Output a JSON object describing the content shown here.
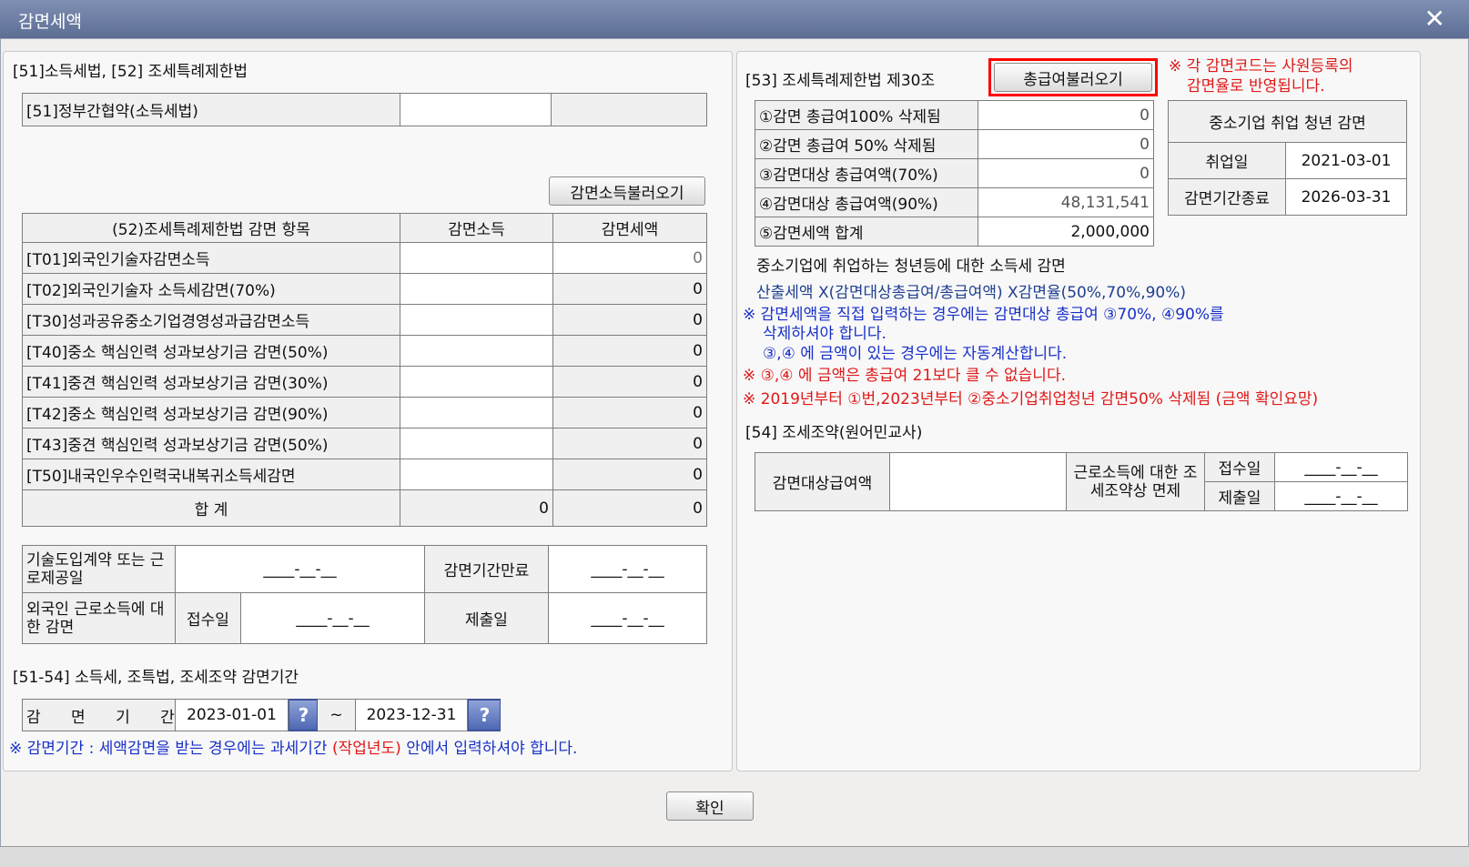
{
  "window": {
    "title": "감면세액",
    "close_icon": "✕"
  },
  "left": {
    "section_title": "[51]소득세법, [52] 조세특례제한법",
    "row51_label": "[51]정부간협약(소득세법)",
    "load_reduction_income_button": "감면소득불러오기",
    "table52": {
      "headers": [
        "(52)조세특례제한법 감면 항목",
        "감면소득",
        "감면세액"
      ],
      "rows": [
        {
          "label": "[T01]외국인기술자감면소득",
          "income": "",
          "tax": "0"
        },
        {
          "label": "[T02]외국인기술자 소득세감면(70%)",
          "income": "",
          "tax": "0"
        },
        {
          "label": "[T30]성과공유중소기업경영성과급감면소득",
          "income": "",
          "tax": "0"
        },
        {
          "label": "[T40]중소 핵심인력 성과보상기금 감면(50%)",
          "income": "",
          "tax": "0"
        },
        {
          "label": "[T41]중견 핵심인력 성과보상기금 감면(30%)",
          "income": "",
          "tax": "0"
        },
        {
          "label": "[T42]중소 핵심인력 성과보상기금 감면(90%)",
          "income": "",
          "tax": "0"
        },
        {
          "label": "[T43]중견 핵심인력 성과보상기금 감면(50%)",
          "income": "",
          "tax": "0"
        },
        {
          "label": "[T50]내국인우수인력국내복귀소득세감면",
          "income": "",
          "tax": "0"
        }
      ],
      "total_label": "합  계",
      "total_income": "0",
      "total_tax": "0"
    },
    "foreign": {
      "contract_label": "기술도입계약 또는 근로제공일",
      "contract_date": "____-__-__",
      "expire_label": "감면기간만료",
      "expire_date": "____-__-__",
      "foreign_label": "외국인 근로소득에 대한 감면",
      "receipt_label": "접수일",
      "receipt_date": "____-__-__",
      "submit_label": "제출일",
      "submit_date": "____-__-__"
    },
    "period_section_title": "[51-54] 소득세, 조특법, 조세조약 감면기간",
    "period_label": "감 면 기 간",
    "period_start": "2023-01-01",
    "period_tilde": "~",
    "period_end": "2023-12-31",
    "help_icon": "?",
    "period_note_prefix": "※ 감면기간 : 세액감면을 받는 경우에는 과세기간",
    "period_note_red": "(작업년도)",
    "period_note_suffix": "안에서 입력하셔야 합니다."
  },
  "right": {
    "section53_title": "[53] 조세특례제한법 제30조",
    "load_total_pay_button": "총급여불러오기",
    "red_note_line1": "※ 각 감면코드는 사원등록의",
    "red_note_line2": "감면율로 반영됩니다.",
    "table53": [
      {
        "label": "①감면 총급여100% 삭제됨",
        "value": "0"
      },
      {
        "label": "②감면 총급여 50% 삭제됨",
        "value": "0"
      },
      {
        "label": "③감면대상 총급여액(70%)",
        "value": "0"
      },
      {
        "label": "④감면대상 총급여액(90%)",
        "value": "48,131,541"
      },
      {
        "label": "⑤감면세액 합계",
        "value": "2,000,000"
      }
    ],
    "youth": {
      "title": "중소기업 취업 청년 감면",
      "hire_label": "취업일",
      "hire_date": "2021-03-01",
      "end_label": "감면기간종료",
      "end_date": "2026-03-31"
    },
    "desc_title": "중소기업에 취업하는 청년등에 대한 소득세 감면",
    "formula": "산출세액 X(감면대상총급여/총급여액) X감면율(50%,70%,90%)",
    "blue_note_1": "※ 감면세액을 직접 입력하는 경우에는 감면대상 총급여 ③70%, ④90%를",
    "blue_note_2": "삭제하셔야 합니다.",
    "blue_note_3": "③,④ 에 금액이 있는 경우에는 자동계산합니다.",
    "red_note_3": "※ ③,④ 에 금액은 총급여 21보다 클 수 없습니다.",
    "red_note_4": "※  2019년부터 ①번,2023년부터 ②중소기업취업청년 감면50% 삭제됨 (금액 확인요망)",
    "section54_title": "[54] 조세조약(원어민교사)",
    "treaty": {
      "target_label": "감면대상급여액",
      "target_value": "",
      "exempt_label": "근로소득에 대한 조세조약상 면제",
      "receipt_label": "접수일",
      "receipt_date": "____-__-__",
      "submit_label": "제출일",
      "submit_date": "____-__-__"
    }
  },
  "footer": {
    "confirm_button": "확인"
  }
}
